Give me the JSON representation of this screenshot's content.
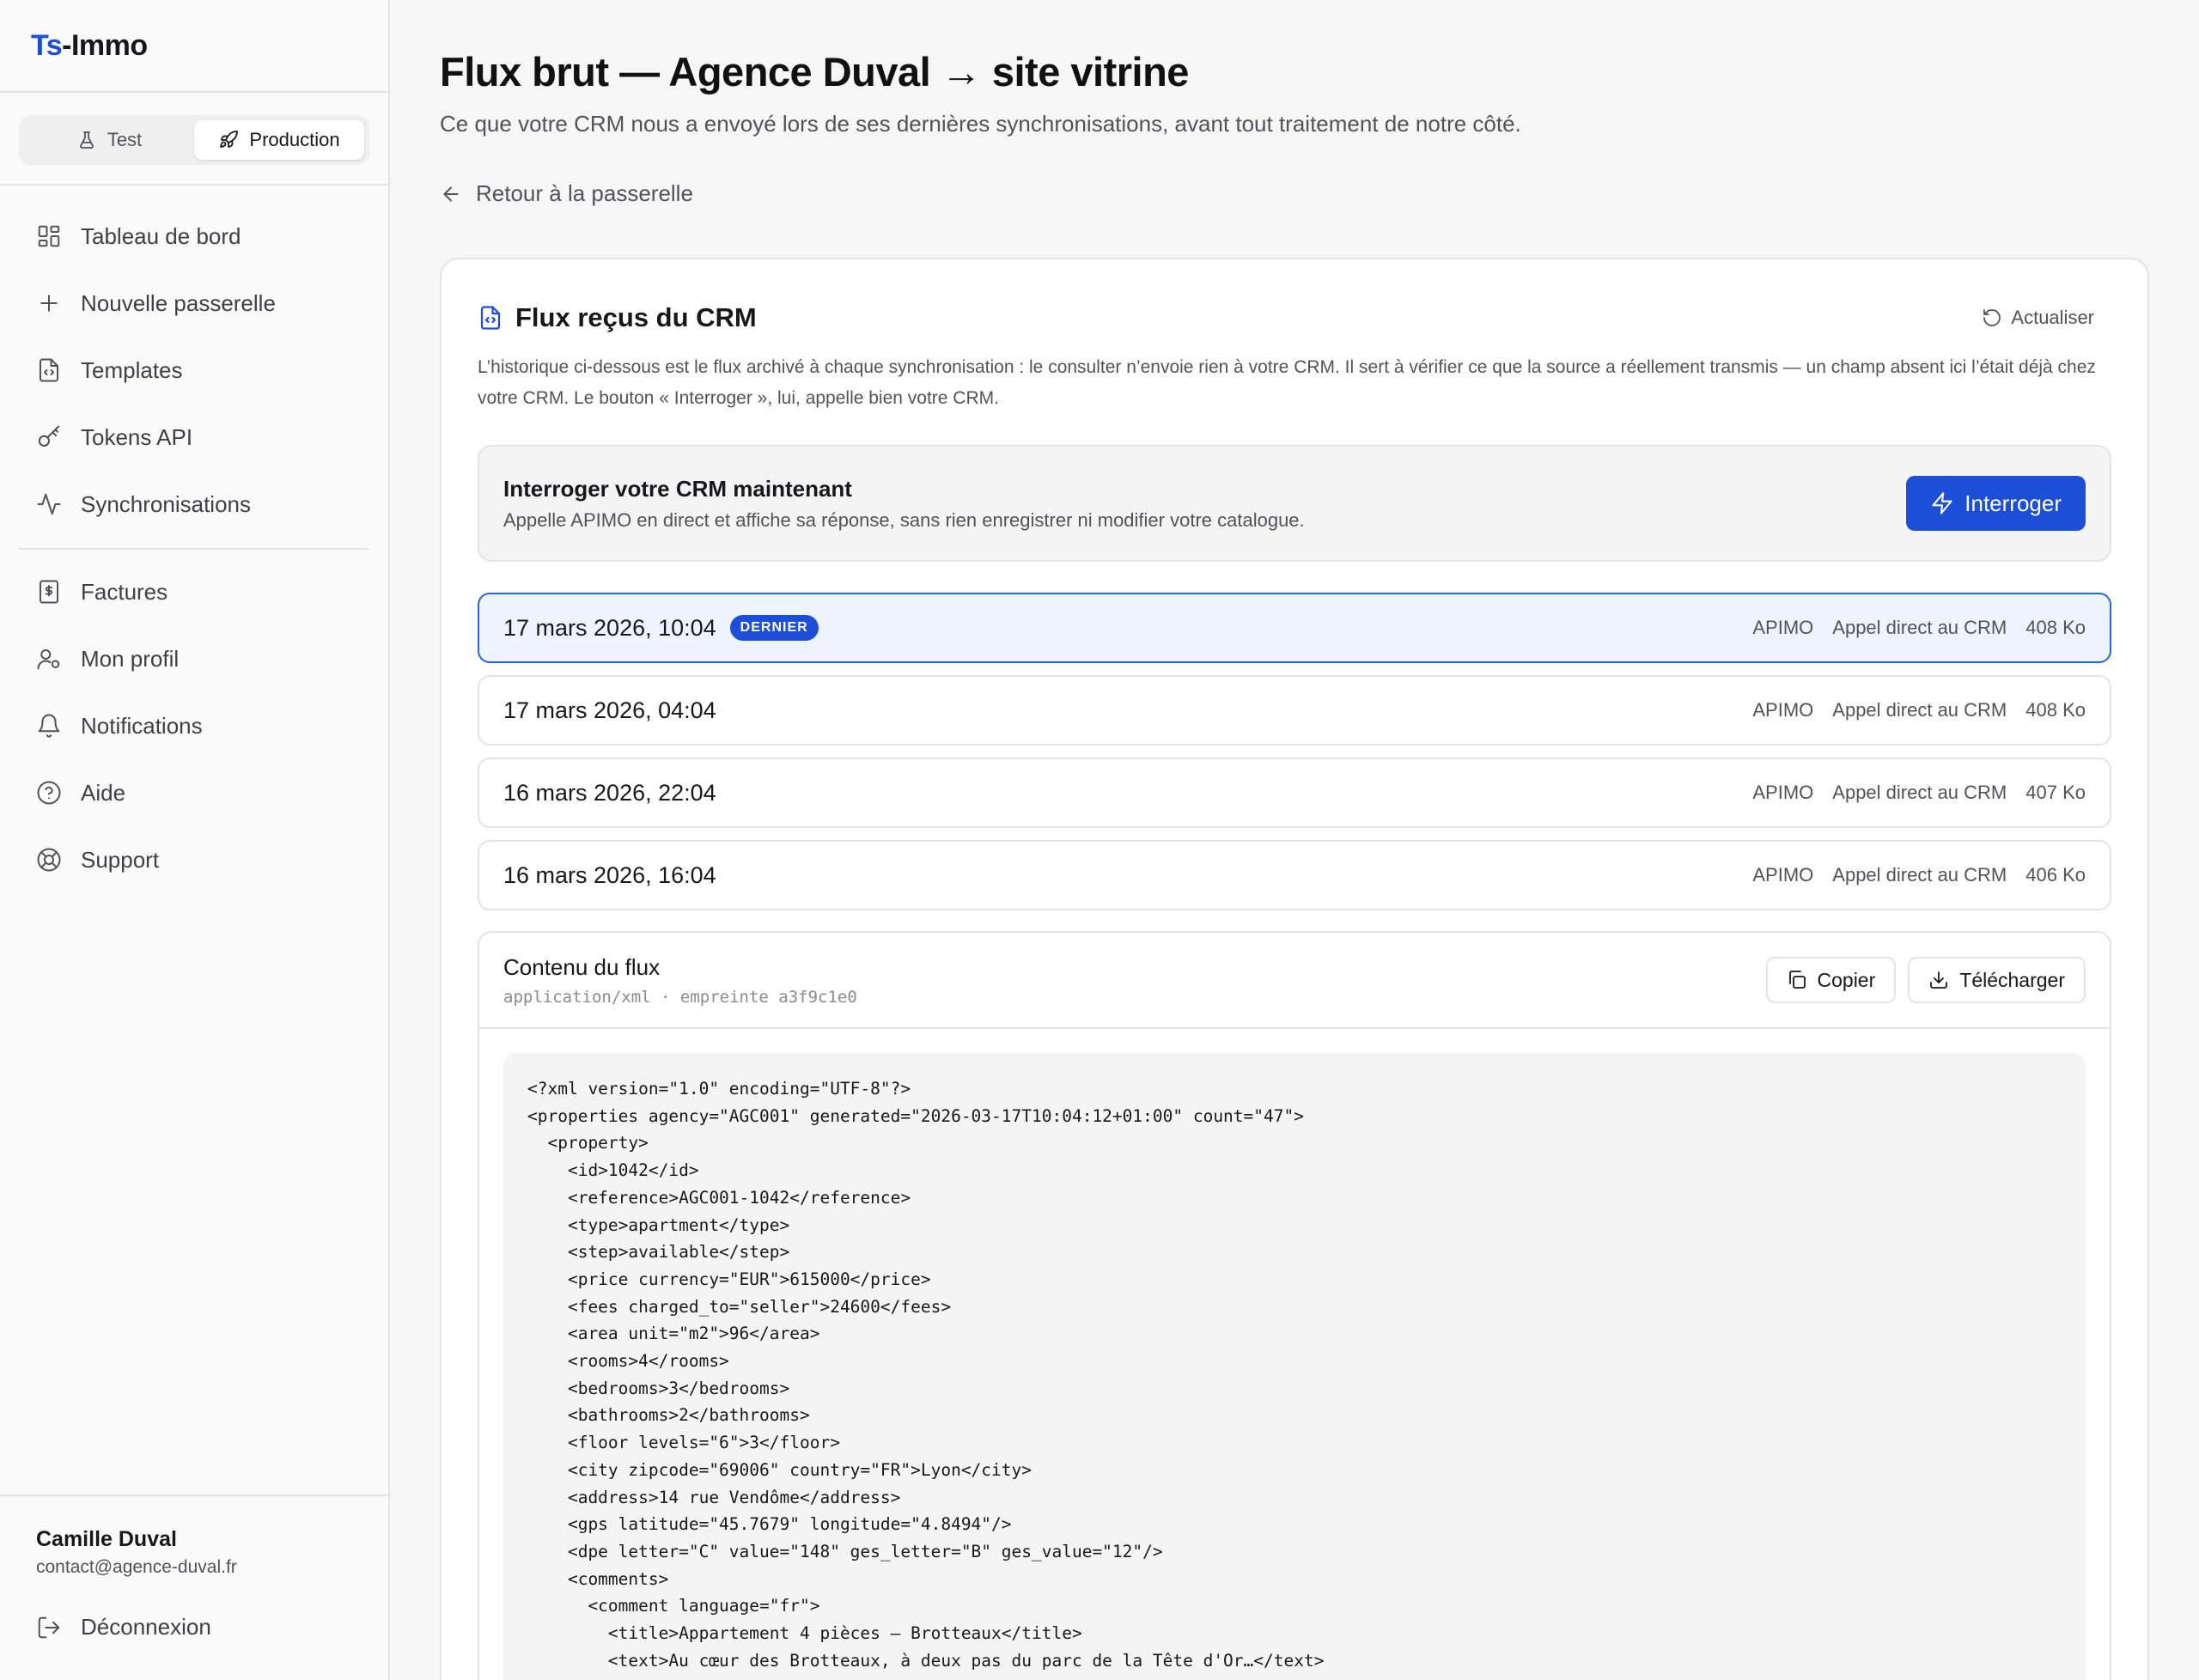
{
  "brand": {
    "part1": "Ts",
    "part2": "-Immo"
  },
  "env": {
    "test_label": "Test",
    "production_label": "Production"
  },
  "nav": [
    {
      "label": "Tableau de bord",
      "icon": "dashboard-icon"
    },
    {
      "label": "Nouvelle passerelle",
      "icon": "plus-icon"
    },
    {
      "label": "Templates",
      "icon": "file-code-icon"
    },
    {
      "label": "Tokens API",
      "icon": "key-icon"
    },
    {
      "label": "Synchronisations",
      "icon": "activity-icon"
    }
  ],
  "nav2": [
    {
      "label": "Factures",
      "icon": "invoice-icon"
    },
    {
      "label": "Mon profil",
      "icon": "user-icon"
    },
    {
      "label": "Notifications",
      "icon": "bell-icon"
    },
    {
      "label": "Aide",
      "icon": "help-icon"
    },
    {
      "label": "Support",
      "icon": "lifebuoy-icon"
    }
  ],
  "user": {
    "name": "Camille Duval",
    "email": "contact@agence-duval.fr",
    "logout_label": "Déconnexion"
  },
  "page": {
    "title": "Flux brut — Agence Duval → site vitrine",
    "subtitle": "Ce que votre CRM nous a envoyé lors de ses dernières synchronisations, avant tout traitement de notre côté.",
    "back_label": "Retour à la passerelle"
  },
  "card": {
    "title": "Flux reçus du CRM",
    "refresh_label": "Actualiser",
    "description": "L’historique ci-dessous est le flux archivé à chaque synchronisation : le consulter n’envoie rien à votre CRM. Il sert à vérifier ce que la source a réellement transmis — un champ absent ici l’était déjà chez votre CRM. Le bouton « Interroger », lui, appelle bien votre CRM."
  },
  "query": {
    "title": "Interroger votre CRM maintenant",
    "subtitle": "Appelle APIMO en direct et affiche sa réponse, sans rien enregistrer ni modifier votre catalogue.",
    "button_label": "Interroger"
  },
  "syncs": [
    {
      "date": "17 mars 2026, 10:04",
      "badge": "DERNIER",
      "source": "APIMO",
      "method": "Appel direct au CRM",
      "size": "408 Ko",
      "active": true
    },
    {
      "date": "17 mars 2026, 04:04",
      "badge": "",
      "source": "APIMO",
      "method": "Appel direct au CRM",
      "size": "408 Ko",
      "active": false
    },
    {
      "date": "16 mars 2026, 22:04",
      "badge": "",
      "source": "APIMO",
      "method": "Appel direct au CRM",
      "size": "407 Ko",
      "active": false
    },
    {
      "date": "16 mars 2026, 16:04",
      "badge": "",
      "source": "APIMO",
      "method": "Appel direct au CRM",
      "size": "406 Ko",
      "active": false
    }
  ],
  "content": {
    "title": "Contenu du flux",
    "meta": "application/xml · empreinte a3f9c1e0",
    "copy_label": "Copier",
    "download_label": "Télécharger",
    "code": "<?xml version=\"1.0\" encoding=\"UTF-8\"?>\n<properties agency=\"AGC001\" generated=\"2026-03-17T10:04:12+01:00\" count=\"47\">\n  <property>\n    <id>1042</id>\n    <reference>AGC001-1042</reference>\n    <type>apartment</type>\n    <step>available</step>\n    <price currency=\"EUR\">615000</price>\n    <fees charged_to=\"seller\">24600</fees>\n    <area unit=\"m2\">96</area>\n    <rooms>4</rooms>\n    <bedrooms>3</bedrooms>\n    <bathrooms>2</bathrooms>\n    <floor levels=\"6\">3</floor>\n    <city zipcode=\"69006\" country=\"FR\">Lyon</city>\n    <address>14 rue Vendôme</address>\n    <gps latitude=\"45.7679\" longitude=\"4.8494\"/>\n    <dpe letter=\"C\" value=\"148\" ges_letter=\"B\" ges_value=\"12\"/>\n    <comments>\n      <comment language=\"fr\">\n        <title>Appartement 4 pièces — Brotteaux</title>\n        <text>Au cœur des Brotteaux, à deux pas du parc de la Tête d'Or…</text>"
  }
}
